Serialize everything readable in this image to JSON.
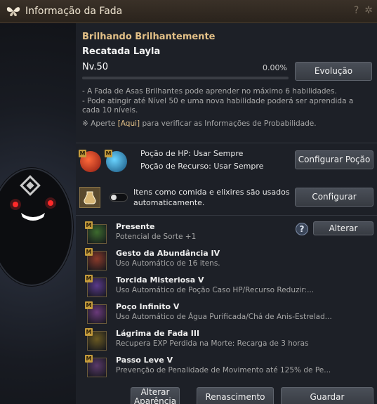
{
  "window": {
    "title": "Informação da Fada"
  },
  "fairy": {
    "title_name": "Brilhando Brilhantemente",
    "name": "Recatada Layla",
    "level": "Nv.50",
    "exp_percent": "0.00%",
    "exp_fraction": 0.0,
    "evolution_button": "Evolução"
  },
  "info": {
    "line1": "- A Fada de Asas Brilhantes pode aprender no máximo 6 habilidades.",
    "line2": "- Pode atingir até Nível 50 e uma nova habilidade poderá ser aprendida a cada 10 níveis.",
    "probability_prefix": "※ Aperte ",
    "probability_link": "[Aqui]",
    "probability_suffix": " para verificar as Informações de Probabilidade."
  },
  "potions": {
    "hp_label": "Poção de HP: Usar Sempre",
    "resource_label": "Poção de Recurso: Usar Sempre",
    "configure_button": "Configurar Poção"
  },
  "food": {
    "label_line1": "Itens como comida e elixires são usados",
    "label_line2": "automaticamente.",
    "configure_button": "Configurar",
    "toggle_on": false
  },
  "skills": [
    {
      "name": "Presente",
      "desc": "Potencial de Sorte +1",
      "tag": "M",
      "icon": "clover-icon",
      "color": "#3d6b2e"
    },
    {
      "name": "Gesto da Abundância IV",
      "desc": "Uso Automático de 16 itens.",
      "tag": "M",
      "icon": "fairy-icon",
      "color": "#8a3a2a"
    },
    {
      "name": "Torcida Misteriosa V",
      "desc": "Uso Automático de Poção Caso HP/Recurso Reduzir:...",
      "tag": "M",
      "icon": "potion-sparkle-icon",
      "color": "#5a3a8a"
    },
    {
      "name": "Poço Infinito V",
      "desc": "Uso Automático de Água Purificada/Chá de Anis-Estrelad...",
      "tag": "M",
      "icon": "bowl-icon",
      "color": "#6a3a7a"
    },
    {
      "name": "Lágrima de Fada III",
      "desc": "Recupera EXP Perdida na Morte: Recarga de 3 horas",
      "tag": "M",
      "icon": "chalice-icon",
      "color": "#6b5a22"
    },
    {
      "name": "Passo Leve V",
      "desc": "Prevenção de Penalidade de Movimento até 125% de Pe...",
      "tag": "M",
      "icon": "boot-icon",
      "color": "#5a3a6a"
    }
  ],
  "skill_controls": {
    "help": "?",
    "change_button": "Alterar"
  },
  "footer": {
    "appearance_button": "Alterar Aparência",
    "rebirth_button": "Renascimento",
    "save_button": "Guardar"
  },
  "colors": {
    "accent_gold": "#e3c087",
    "exp_bar": "#c8a25a"
  }
}
